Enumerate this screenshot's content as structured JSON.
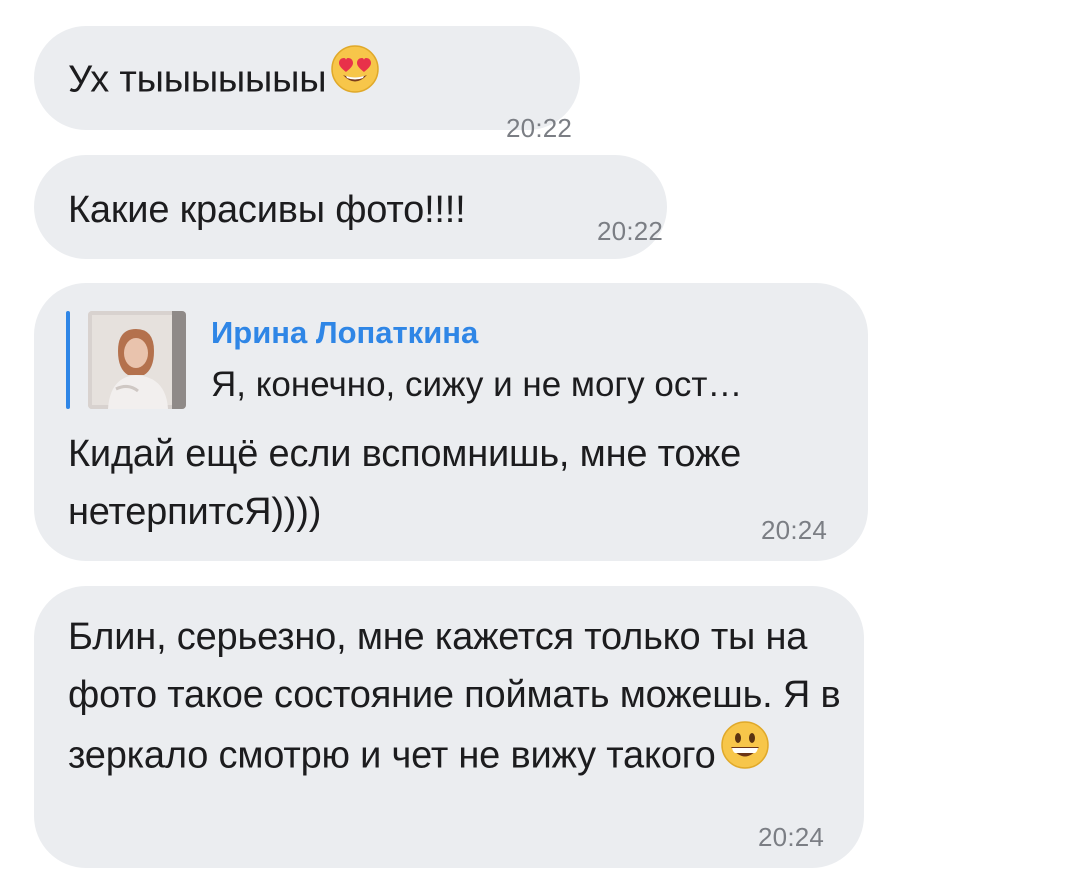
{
  "messages": [
    {
      "text": "Ух тыыыыыыы",
      "emoji": "heart-eyes-emoji",
      "time": "20:22"
    },
    {
      "text": "Какие красивы фото!!!!",
      "time": "20:22"
    },
    {
      "reply": {
        "author": "Ирина Лопаткина",
        "snippet": "Я, конечно, сижу и не могу ост…",
        "thumbnail": "portrait-photo-thumbnail"
      },
      "text": "Кидай ещё если вспомнишь, мне тоже нетерпитсЯ))))",
      "time": "20:24"
    },
    {
      "text": "Блин, серьезно, мне кажется только ты на фото такое состояние поймать можешь. Я в зеркало смотрю и чет не вижу такого",
      "emoji": "grinning-face-emoji",
      "time": "20:24"
    }
  ],
  "colors": {
    "bubble_bg": "#ebedf0",
    "accent": "#2f86e6",
    "time_text": "#7b7e84",
    "text": "#1c1c1e"
  }
}
